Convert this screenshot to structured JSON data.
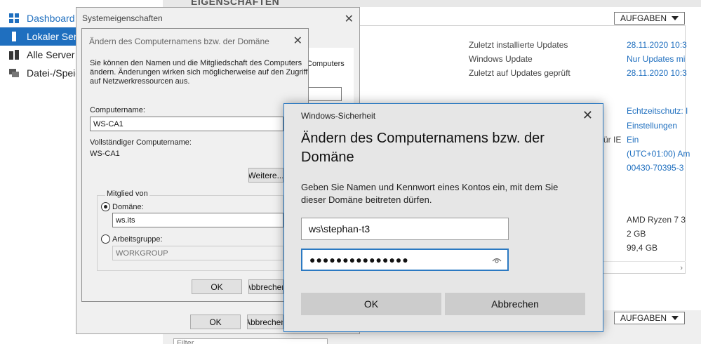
{
  "sidebar": {
    "items": [
      {
        "label": "Dashboard"
      },
      {
        "label": "Lokaler Server"
      },
      {
        "label": "Alle Server"
      },
      {
        "label": "Datei-/Speicherdienste"
      }
    ]
  },
  "properties": {
    "title": "EIGENSCHAFTEN",
    "tasks_label": "AUFGABEN",
    "rows": [
      {
        "label": "Zuletzt installierte Updates",
        "value": "28.11.2020 10:3"
      },
      {
        "label": "Windows Update",
        "value": "Nur Updates mi"
      },
      {
        "label": "Zuletzt auf Updates geprüft",
        "value": "28.11.2020 10:3"
      }
    ],
    "right_values": [
      "Echtzeitschutz: I",
      "Einstellungen",
      "Ein",
      "(UTC+01:00) Am",
      "00430-70395-3"
    ],
    "ie_fragment": "ür IE",
    "hardware": [
      "AMD Ryzen 7 3",
      "2 GB",
      "99,4 GB"
    ]
  },
  "lower_section": {
    "tasks_label": "AUFGABEN",
    "filter_placeholder": "Filter"
  },
  "system_properties": {
    "title": "Systemeigenschaften",
    "inner_text": "Computers",
    "ok_label": "OK",
    "cancel_label": "Abbrechen"
  },
  "rename_dialog": {
    "title": "Ändern des Computernamens bzw. der Domäne",
    "description_lines": [
      "Sie können den Namen und die Mitgliedschaft des Computers",
      "ändern. Änderungen wirken sich möglicherweise auf den Zugriff",
      "auf Netzwerkressourcen aus."
    ],
    "computer_name_label": "Computername:",
    "computer_name_value": "WS-CA1",
    "full_name_label": "Vollständiger Computername:",
    "full_name_value": "WS-CA1",
    "more_button": "Weitere...",
    "member_of_label": "Mitglied von",
    "domain_label": "Domäne:",
    "domain_value": "ws.its",
    "workgroup_label": "Arbeitsgruppe:",
    "workgroup_value": "WORKGROUP",
    "ok_label": "OK",
    "cancel_label": "Abbrechen"
  },
  "windows_security": {
    "title": "Windows-Sicherheit",
    "heading_lines": [
      "Ändern des Computernamens bzw. der",
      "Domäne"
    ],
    "description_lines": [
      "Geben Sie Namen und Kennwort eines Kontos ein, mit dem Sie",
      "dieser Domäne beitreten dürfen."
    ],
    "username_value": "ws\\stephan-t3",
    "password_masked": "●●●●●●●●●●●●●●●",
    "ok_label": "OK",
    "cancel_label": "Abbrechen"
  }
}
